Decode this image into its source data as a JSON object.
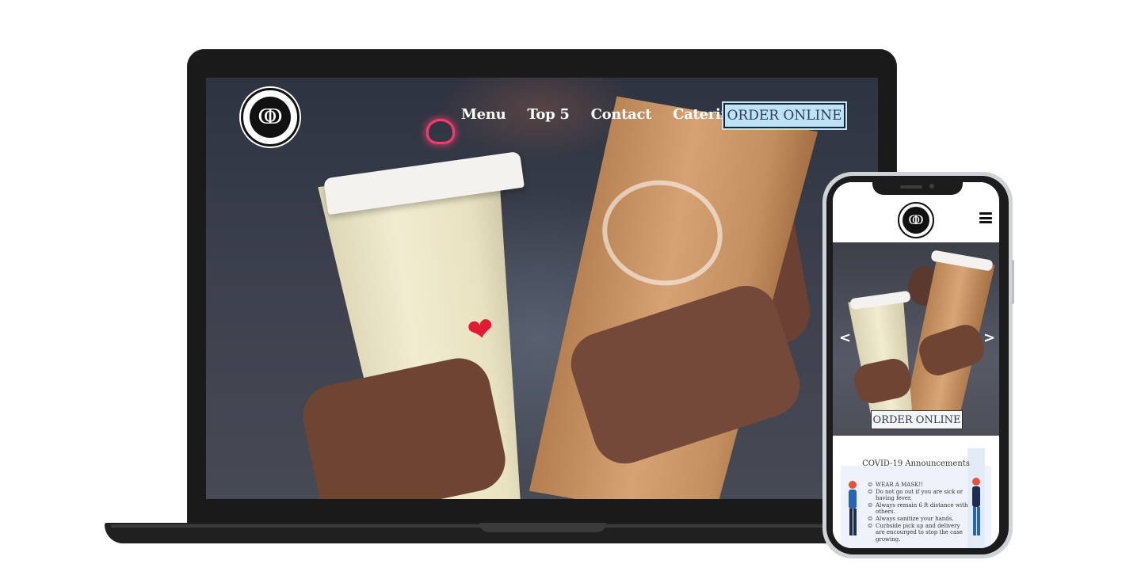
{
  "desktop": {
    "logo_symbol": "ↂ",
    "nav": {
      "links": [
        "Menu",
        "Top 5",
        "Contact",
        "Catering"
      ],
      "order_button": "ORDER ONLINE"
    }
  },
  "mobile": {
    "logo_symbol": "ↂ",
    "hero": {
      "prev_arrow": "<",
      "next_arrow": ">",
      "order_button": "ORDER ONLINE"
    },
    "covid": {
      "title": "COVID-19 Announcements",
      "items": [
        "WEAR A MASK!!",
        "Do not go out if you are sick or having fever.",
        "Always remain 6 ft distance with others.",
        "Always sanitize your hands.",
        "Curbside pick up and delivery are encourged to stop the case growing."
      ]
    }
  },
  "icons": {
    "menu": "hamburger-menu-icon",
    "prev": "chevron-left-icon",
    "next": "chevron-right-icon",
    "bullet": "smiley-icon"
  },
  "colors": {
    "order_button_bg": "#bfe3f6",
    "device_frame": "#1a1a1a",
    "page_bg": "#ffffff"
  }
}
